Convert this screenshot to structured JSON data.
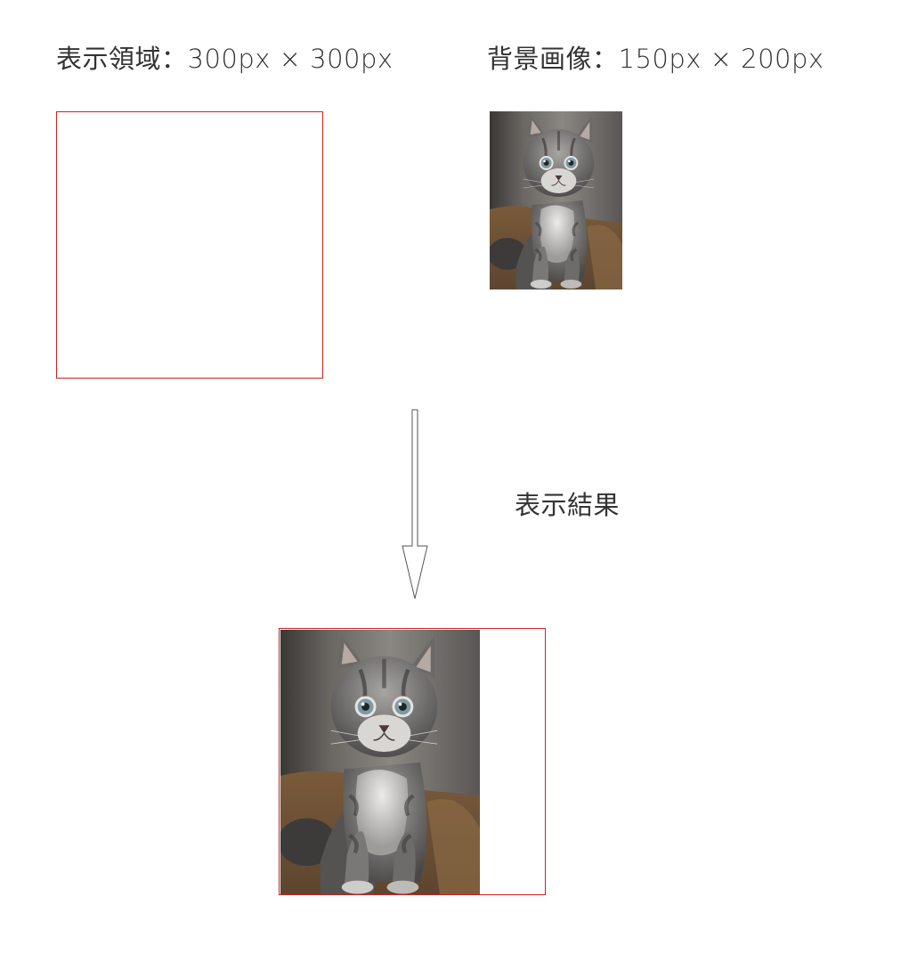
{
  "labels": {
    "display_area": "表示領域：300px × 300px",
    "background_image": "背景画像：150px × 200px",
    "result": "表示結果"
  },
  "images": {
    "kitten": "kitten-photo"
  },
  "colors": {
    "frame_border": "#cc2222",
    "text": "#333333",
    "arrow_stroke": "#555555"
  }
}
